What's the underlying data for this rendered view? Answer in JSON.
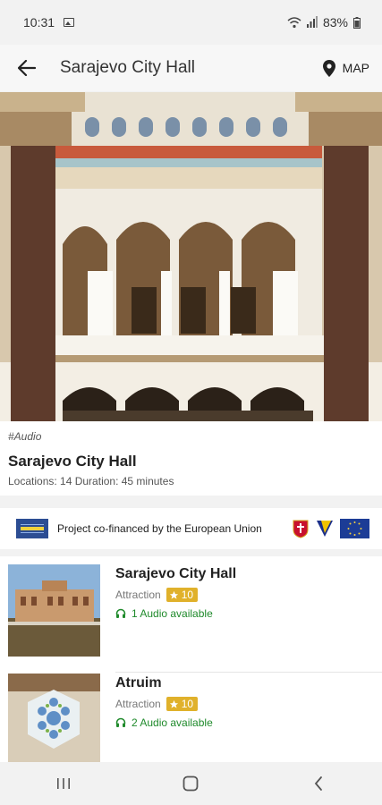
{
  "status_bar": {
    "time": "10:31",
    "battery": "83%"
  },
  "app_bar": {
    "title": "Sarajevo City Hall",
    "map_label": "MAP"
  },
  "tour": {
    "tag": "#Audio",
    "title": "Sarajevo City Hall",
    "meta": "Locations: 14 Duration: 45 minutes"
  },
  "banner": {
    "text": "Project co-financed by the European Union"
  },
  "list": [
    {
      "name": "Sarajevo City Hall",
      "type": "Attraction",
      "rating": "10",
      "audio": "1 Audio available"
    },
    {
      "name": "Atruim",
      "type": "Attraction",
      "rating": "10",
      "audio": "2 Audio available"
    }
  ],
  "colors": {
    "rating_badge": "#e0b12b",
    "audio_green": "#1f8a2b",
    "eu_blue": "#2c4d93"
  }
}
